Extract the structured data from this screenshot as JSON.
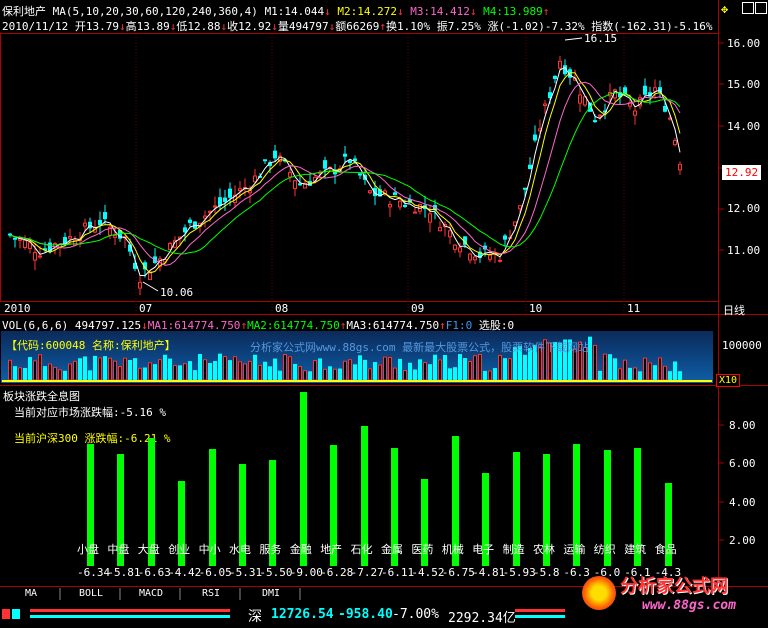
{
  "header": {
    "stock_name": "保利地产",
    "ma_params": "MA(5,10,20,30,60,120,240,360,4)",
    "m1": "M1:14.044",
    "m2": "M2:14.272",
    "m3": "M3:14.412",
    "m4": "M4:13.989",
    "date": "2010/11/12",
    "open": "开13.79",
    "high": "高13.89",
    "low": "低12.88",
    "close": "收12.92",
    "volume": "量494797",
    "amount": "额66269",
    "turnover": "换1.10%",
    "amplitude": "振7.25%",
    "change": "涨(-1.02)-7.32%",
    "index": "指数(-162.31)-5.16%"
  },
  "price_axis": {
    "ticks": [
      "16.00",
      "15.00",
      "14.00",
      "13.00",
      "12.00",
      "11.00"
    ],
    "current_price": "12.92",
    "high_label": "16.15",
    "low_label": "10.06"
  },
  "time_axis": {
    "labels": [
      "2010",
      "07",
      "08",
      "09",
      "10",
      "11"
    ],
    "period": "日线"
  },
  "volume_header": {
    "params": "VOL(6,6,6)",
    "vol": "494797.125",
    "ma1": "MA1:614774.750",
    "ma2": "MA2:614774.750",
    "ma3": "MA3:614774.750",
    "f1": "F1",
    "f1v": "0",
    "select": "选股:0"
  },
  "volume_panel": {
    "code_label": "【代码:600048 名称:保利地产】",
    "watermark": "分析家公式网www.88gs.com 最新最大股票公式，股票软件下载网站",
    "tick": "100000",
    "unit": "X10"
  },
  "sector_panel": {
    "title": "板块涨跌全息图",
    "market_label": "当前对应市场涨跌幅:-5.16 %",
    "hs300_label": "当前沪深300 涨跌幅:-6.21 %",
    "ticks": [
      "8.00",
      "6.00",
      "4.00",
      "2.00"
    ],
    "sectors": [
      {
        "name": "小盘",
        "value": "-6.34",
        "height": 6.34
      },
      {
        "name": "中盘",
        "value": "-5.81",
        "height": 5.81
      },
      {
        "name": "大盘",
        "value": "-6.63",
        "height": 6.63
      },
      {
        "name": "创业",
        "value": "-4.42",
        "height": 4.42
      },
      {
        "name": "中小",
        "value": "-6.05",
        "height": 6.05
      },
      {
        "name": "水电",
        "value": "-5.31",
        "height": 5.31
      },
      {
        "name": "服务",
        "value": "-5.50",
        "height": 5.5
      },
      {
        "name": "金融",
        "value": "-9.00",
        "height": 9.0
      },
      {
        "name": "地产",
        "value": "-6.28",
        "height": 6.28
      },
      {
        "name": "石化",
        "value": "-7.27",
        "height": 7.27
      },
      {
        "name": "金属",
        "value": "-6.11",
        "height": 6.11
      },
      {
        "name": "医药",
        "value": "-4.52",
        "height": 4.52
      },
      {
        "name": "机械",
        "value": "-6.75",
        "height": 6.75
      },
      {
        "name": "电子",
        "value": "-4.81",
        "height": 4.81
      },
      {
        "name": "制造",
        "value": "-5.93",
        "height": 5.93
      },
      {
        "name": "农林",
        "value": "-5.8",
        "height": 5.8
      },
      {
        "name": "运输",
        "value": "-6.3",
        "height": 6.3
      },
      {
        "name": "纺织",
        "value": "-6.0",
        "height": 6.0
      },
      {
        "name": "建筑",
        "value": "-6.1",
        "height": 6.1
      },
      {
        "name": "食品",
        "value": "-4.3",
        "height": 4.3
      }
    ]
  },
  "tabs": [
    "MA",
    "BOLL",
    "MACD",
    "RSI",
    "DMI"
  ],
  "footer": {
    "market": "深",
    "index_value": "12726.54",
    "index_change": "-958.40",
    "index_pct": "-7.00%",
    "amount": "2292.34亿"
  },
  "logo": {
    "title": "分析家公式网",
    "url": "www.88gs.com"
  },
  "colors": {
    "up": "#ff3333",
    "down": "#00ffff",
    "ma1": "#ffffff",
    "ma2": "#ffff00",
    "ma3": "#ff66cc",
    "ma4": "#00ff00",
    "grid": "#aa0000",
    "bar": "#00ff00"
  }
}
